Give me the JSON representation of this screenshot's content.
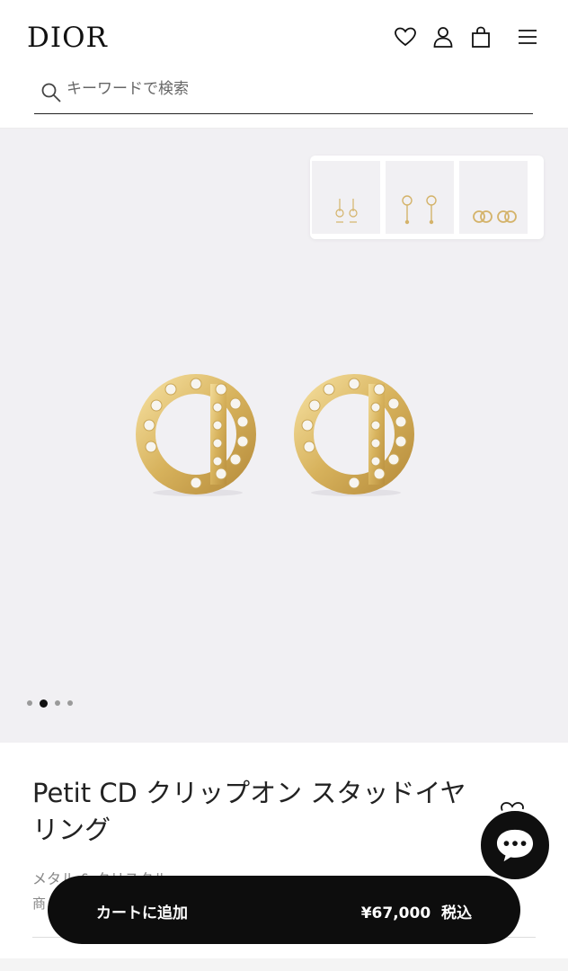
{
  "header": {
    "logo": "DIOR",
    "icons": [
      "heart-icon",
      "user-icon",
      "shopping-bag-icon",
      "menu-icon"
    ]
  },
  "search": {
    "placeholder": "キーワードで検索",
    "value": ""
  },
  "gallery": {
    "thumbnails": [
      "earring-dangle-thumbnail",
      "earring-pendant-thumbnail",
      "earring-cd-thumbnail"
    ],
    "dots_total": 4,
    "active_dot": 2,
    "background": "#f1f0f3",
    "gold": "#d8b564"
  },
  "product": {
    "title": "Petit CD クリップオン スタッドイヤリング",
    "subtitle": "メタル & クリスタル",
    "item_prefix": "商"
  },
  "cart": {
    "label": "カートに追加",
    "price": "¥67,000",
    "tax": "税込"
  }
}
